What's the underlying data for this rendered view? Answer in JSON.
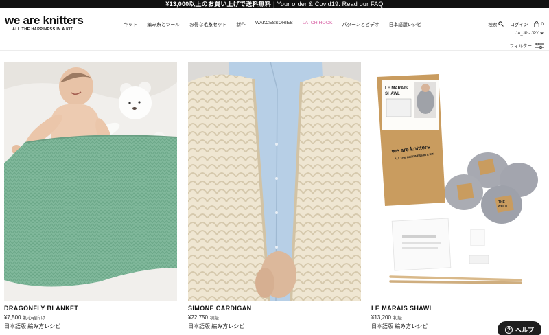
{
  "announcement": {
    "promo": "¥13,000以上のお買い上げで送料無料",
    "separator": "|",
    "note": "Your order & Covid19. Read our FAQ"
  },
  "logo": {
    "name": "we are knitters",
    "tagline": "ALL THE HAPPINESS IN A KIT"
  },
  "nav": {
    "items": [
      {
        "label": "キット"
      },
      {
        "label": "編み糸とツール"
      },
      {
        "label": "お得な毛糸セット"
      },
      {
        "label": "新作"
      },
      {
        "label": "WAKCESSORIES"
      },
      {
        "label": "LATCH HOOK"
      },
      {
        "label": "パターンとビデオ"
      },
      {
        "label": "日本語版レシピ"
      }
    ]
  },
  "header_right": {
    "search_label": "検索",
    "login_label": "ログイン",
    "cart_count": "0",
    "currency": "JA_JP - JPY",
    "filter_label": "フィルター"
  },
  "products": [
    {
      "name": "DRAGONFLY BLANKET",
      "price": "¥7,500",
      "level": "初心者向け",
      "pattern": "日本語版 編み方レシピ"
    },
    {
      "name": "SIMONE CARDIGAN",
      "price": "¥22,750",
      "level": "初級",
      "pattern": "日本語版 編み方レシピ"
    },
    {
      "name": "LE MARAIS SHAWL",
      "price": "¥13,200",
      "level": "初級",
      "pattern": "日本語版 編み方レシピ"
    }
  ],
  "kit_box": {
    "title_line1": "LE MARAIS",
    "title_line2": "SHAWL",
    "brand": "we are knitters",
    "tagline": "ALL THE HAPPINESS IN A KIT",
    "label_line1": "THE",
    "label_line2": "WOOL"
  },
  "help": {
    "label": "ヘルプ"
  },
  "colors": {
    "latch_hook": "#d75fa3",
    "blanket": "#7fb79a",
    "cardigan": "#ece3cf",
    "shirt": "#b9d1e8",
    "kit_box": "#c79a5d",
    "yarn": "#a6a8b0"
  }
}
